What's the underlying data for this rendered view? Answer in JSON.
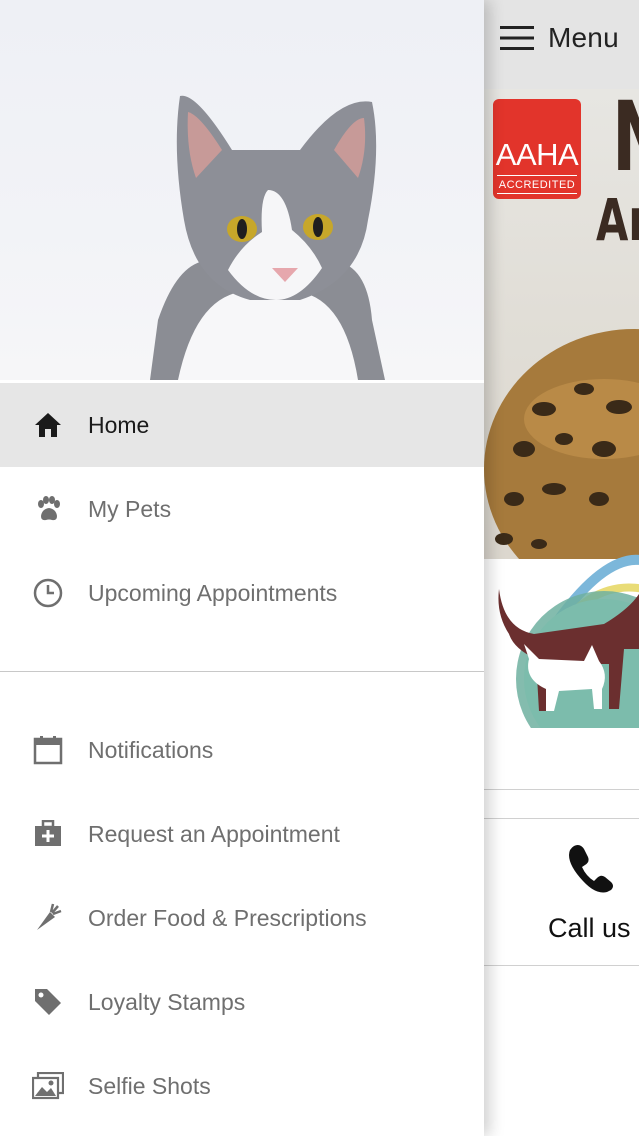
{
  "header": {
    "menu_label": "Menu",
    "menu_icon": "hamburger-icon"
  },
  "hero": {
    "badge_text": "AAHA",
    "badge_subtext": "ACCREDITED",
    "badge_color": "#e2342b",
    "clinic_name_partial_1": "N",
    "clinic_name_partial_2": "Ar"
  },
  "call_card": {
    "label": "Call us",
    "icon": "phone-icon"
  },
  "drawer": {
    "hero_image": "gray-and-white-cat-photo",
    "active_bg": "#e6e6e6",
    "items_top": [
      {
        "label": "Home",
        "icon": "home-icon",
        "active": true
      },
      {
        "label": "My Pets",
        "icon": "paw-icon",
        "active": false
      },
      {
        "label": "Upcoming Appointments",
        "icon": "clock-icon",
        "active": false
      }
    ],
    "items_bottom": [
      {
        "label": "Notifications",
        "icon": "calendar-icon"
      },
      {
        "label": "Request an Appointment",
        "icon": "medical-kit-icon"
      },
      {
        "label": "Order Food & Prescriptions",
        "icon": "carrot-icon"
      },
      {
        "label": "Loyalty Stamps",
        "icon": "tag-icon"
      },
      {
        "label": "Selfie Shots",
        "icon": "photos-icon"
      }
    ]
  }
}
